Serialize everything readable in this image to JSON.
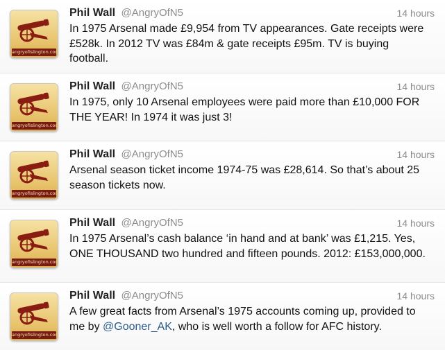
{
  "avatar_caption": "angryofislington.com",
  "tweets": [
    {
      "name": "Phil Wall",
      "handle": "@AngryOfN5",
      "time": "14 hours",
      "text": "In 1975 Arsenal made £9,954 from TV appearances. Gate receipts were £528k. In 2012 TV was £84m & gate receipts £95m. TV is buying football."
    },
    {
      "name": "Phil Wall",
      "handle": "@AngryOfN5",
      "time": "14 hours",
      "text": "In 1975, only 10 Arsenal employees were paid more than £10,000 FOR THE YEAR! In 1974 it was just 3!"
    },
    {
      "name": "Phil Wall",
      "handle": "@AngryOfN5",
      "time": "14 hours",
      "text": "Arsenal season ticket income 1974-75 was £28,614. So that’s about 25 season tickets now."
    },
    {
      "name": "Phil Wall",
      "handle": "@AngryOfN5",
      "time": "14 hours",
      "text": "In 1975 Arsenal’s cash balance ‘in hand and at bank’ was £1,215. Yes, ONE THOUSAND two hundred and fifteen pounds.  2012: £153,000,000."
    },
    {
      "name": "Phil Wall",
      "handle": "@AngryOfN5",
      "time": "14 hours",
      "text_before": "A few great facts from Arsenal’s 1975 accounts coming up, provided to me by ",
      "mention": "@Gooner_AK",
      "text_after": ", who is well worth a follow for AFC history."
    }
  ]
}
